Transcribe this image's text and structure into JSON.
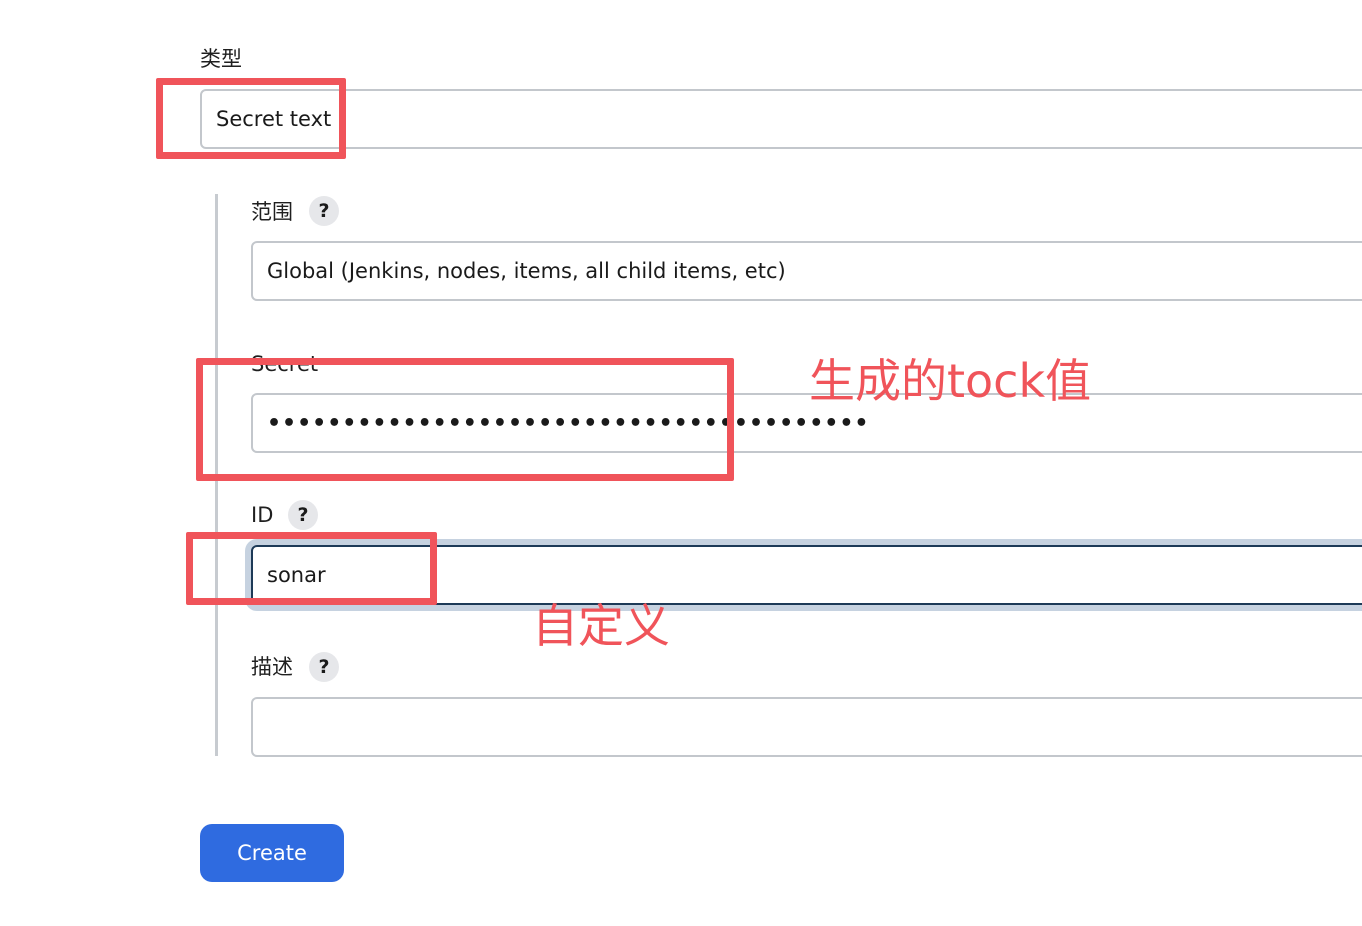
{
  "form": {
    "kind_label": "类型",
    "kind_value": "Secret text",
    "scope_label": "范围",
    "scope_help": "?",
    "scope_value": "Global (Jenkins, nodes, items, all child items, etc)",
    "secret_label": "Secret",
    "secret_value": "••••••••••••••••••••••••••••••••••••••••",
    "id_label": "ID",
    "id_help": "?",
    "id_value": "sonar",
    "description_label": "描述",
    "description_help": "?",
    "description_value": "",
    "create_label": "Create"
  },
  "annotations": {
    "secret_note": "生成的tock值",
    "id_note": "自定义",
    "color": "#f0545a"
  },
  "colors": {
    "primary_button": "#2f6be0",
    "focus_ring": "#c6d2e0",
    "field_border": "#c3c7cc"
  }
}
